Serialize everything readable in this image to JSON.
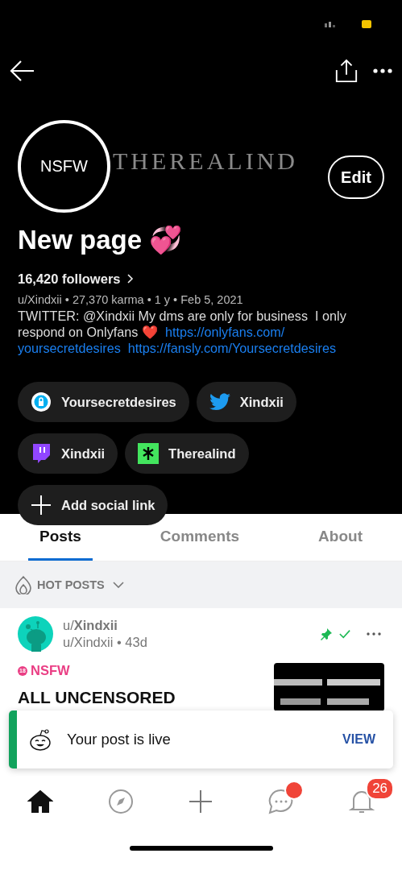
{
  "profile": {
    "avatar_label": "NSFW",
    "banner_text": "THEREALIND",
    "edit_label": "Edit",
    "name": "New page 💞",
    "followers": "16,420 followers",
    "meta": "u/Xindxii • 27,370 karma • 1 y • Feb 5, 2021",
    "bio": {
      "text": "TWITTER: @Xindxii My dms are only for business  I only respond on Onlyfans ❤️",
      "links": [
        "https://onlyfans.com/",
        "yoursecretdesires",
        "https://fansly.com/Yoursecretdesires"
      ]
    }
  },
  "social_links": [
    {
      "kind": "onlyfans",
      "label": "Yoursecretdesires"
    },
    {
      "kind": "twitter",
      "label": "Xindxii"
    },
    {
      "kind": "twitch",
      "label": "Xindxii"
    },
    {
      "kind": "linktree",
      "label": "Therealind"
    },
    {
      "kind": "add",
      "label": "Add social link"
    }
  ],
  "tabs": [
    {
      "label": "Posts",
      "selected": true
    },
    {
      "label": "Comments",
      "selected": false
    },
    {
      "label": "About",
      "selected": false
    }
  ],
  "sort": {
    "label": "HOT POSTS"
  },
  "post": {
    "author": "u/**Xindxii**",
    "byline": "u/Xindxii • 43d",
    "pinned": true,
    "approved": true,
    "tag_badge": "18",
    "tag": "NSFW",
    "title": "ALL UNCENSORED"
  },
  "toast": {
    "message": "Your post is live",
    "action": "VIEW"
  },
  "bottom_nav": [
    {
      "kind": "home",
      "selected": true
    },
    {
      "kind": "discover",
      "selected": false
    },
    {
      "kind": "create",
      "selected": false
    },
    {
      "kind": "chat",
      "selected": false,
      "badge_dot": true
    },
    {
      "kind": "inbox",
      "selected": false,
      "badge": "26"
    }
  ]
}
